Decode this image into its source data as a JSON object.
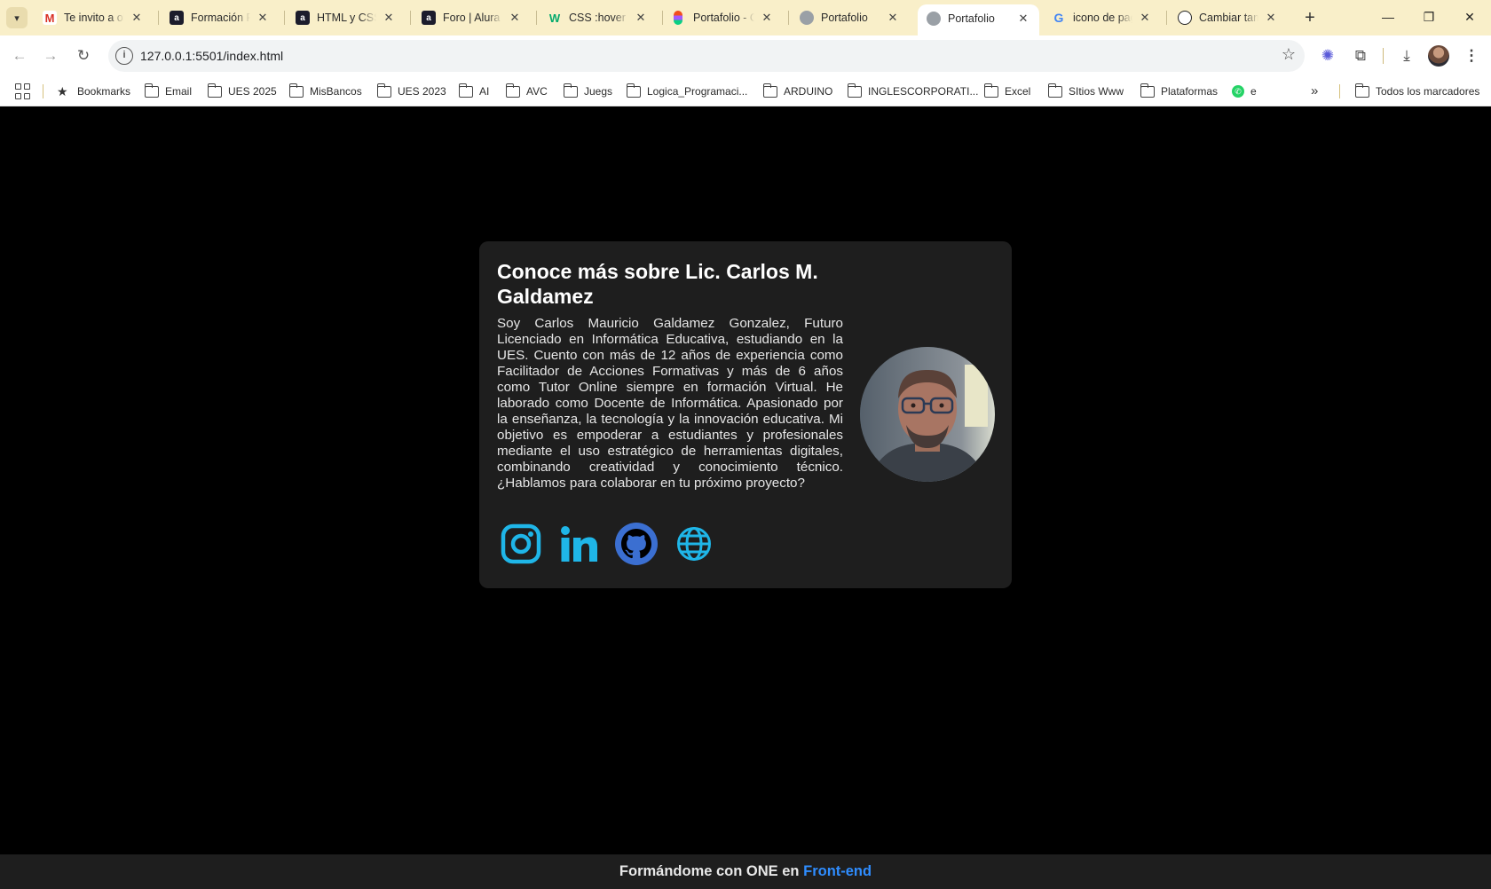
{
  "browser": {
    "tabs": [
      {
        "title": "Te invito a ob",
        "favicon": "gmail-icon"
      },
      {
        "title": "Formación Pr",
        "favicon": "alura-icon"
      },
      {
        "title": "HTML y CSS:",
        "favicon": "alura-icon"
      },
      {
        "title": "Foro | Alura L",
        "favicon": "alura-icon"
      },
      {
        "title": "CSS :hover Ps",
        "favicon": "w3schools-icon"
      },
      {
        "title": "Portafolio - C",
        "favicon": "figma-icon"
      },
      {
        "title": "Portafolio",
        "favicon": "globe-icon"
      },
      {
        "title": "Portafolio",
        "favicon": "globe-icon",
        "active": true
      },
      {
        "title": "icono de pag",
        "favicon": "google-icon"
      },
      {
        "title": "Cambiar tam",
        "favicon": "chatgpt-icon"
      }
    ],
    "address": "127.0.0.1:5501/index.html",
    "bookmarks": [
      {
        "label": "Bookmarks",
        "icon": "star-icon"
      },
      {
        "label": "Email",
        "icon": "folder-icon"
      },
      {
        "label": "UES 2025",
        "icon": "folder-icon"
      },
      {
        "label": "MisBancos",
        "icon": "folder-icon"
      },
      {
        "label": "UES 2023",
        "icon": "folder-icon"
      },
      {
        "label": "AI",
        "icon": "folder-icon"
      },
      {
        "label": "AVC",
        "icon": "folder-icon"
      },
      {
        "label": "Juegs",
        "icon": "folder-icon"
      },
      {
        "label": "Logica_Programaci...",
        "icon": "folder-icon"
      },
      {
        "label": "ARDUINO",
        "icon": "folder-icon"
      },
      {
        "label": "INGLESCORPORATI...",
        "icon": "folder-icon"
      },
      {
        "label": "Excel",
        "icon": "folder-icon"
      },
      {
        "label": "SItios Www",
        "icon": "folder-icon"
      },
      {
        "label": "Plataformas",
        "icon": "folder-icon"
      },
      {
        "label": "e",
        "icon": "whatsapp-icon"
      }
    ],
    "all_bookmarks": "Todos los marcadores",
    "colors": {
      "tabstrip": "#f9efc9",
      "toolbar": "#ffffff"
    }
  },
  "page": {
    "title": "Conoce más sobre Lic. Carlos M. Galdamez",
    "bio": "Soy Carlos Mauricio Galdamez Gonzalez, Futuro Licenciado en Informática Educativa, estudiando en la UES. Cuento con más de 12 años de experiencia como Facilitador de Acciones Formativas y más de 6 años como Tutor Online siempre en formación Virtual. He laborado como Docente de Informática. Apasionado por la enseñanza, la tecnología y la innovación educativa. Mi objetivo es empoderar a estudiantes y profesionales mediante el uso estratégico de herramientas digitales, combinando creatividad y conocimiento técnico. ¿Hablamos para colaborar en tu próximo proyecto?",
    "socials": [
      "instagram-icon",
      "linkedin-icon",
      "github-icon",
      "globe-icon"
    ],
    "colors": {
      "background": "#000000",
      "card": "#1e1e1e",
      "icon_accent": "#1fb6e8",
      "github": "#3b6fd1"
    }
  },
  "footer": {
    "text": "Formándome con ONE en ",
    "accent": "Front-end",
    "accent_color": "#2f8dff"
  }
}
